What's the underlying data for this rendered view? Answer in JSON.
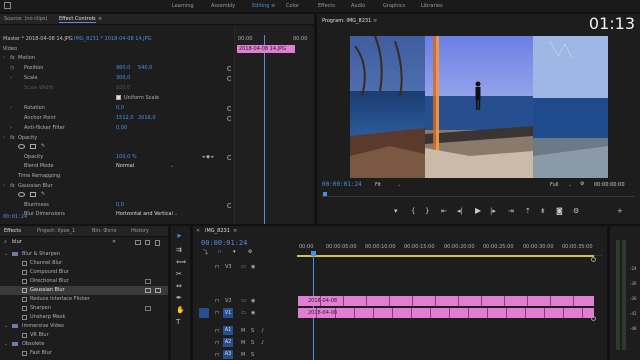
{
  "workspaces": [
    "Learning",
    "Assembly",
    "Editing",
    "Color",
    "Effects",
    "Audio",
    "Graphics",
    "Libraries"
  ],
  "active_workspace": "Editing",
  "clock": "01:13",
  "effect_controls": {
    "tabs": [
      "Source: (no clips)",
      "Effect Controls"
    ],
    "header_source": "Master * 2018-04-08 14.JPG",
    "header_clip": "IMG_8231 * 2018-04-08 14.JPG",
    "section": "Video",
    "ruler_start": "00:00",
    "ruler_end": "00:00",
    "clip_label": "2018-04-08 14.JPG",
    "motion_label": "Motion",
    "rows": [
      {
        "label": "Position",
        "v1": "960,0",
        "v2": "540,0"
      },
      {
        "label": "Scale",
        "v1": "300,0",
        "v2": ""
      },
      {
        "label": "Scale Width",
        "v1": "100,0",
        "v2": ""
      },
      {
        "label": "Uniform Scale",
        "v1": "",
        "v2": ""
      },
      {
        "label": "Rotation",
        "v1": "0,0",
        "v2": ""
      },
      {
        "label": "Anchor Point",
        "v1": "1512,0",
        "v2": "2016,0"
      },
      {
        "label": "Anti-flicker Filter",
        "v1": "0,00",
        "v2": ""
      }
    ],
    "opacity_label": "Opacity",
    "opacity_value": "100,0 %",
    "blend_label": "Blend Mode",
    "blend_value": "Normal",
    "time_remap": "Time Remapping",
    "gaussian": "Gaussian Blur",
    "blurriness_label": "Blurriness",
    "blurriness_value": "0,0",
    "blur_dim_label": "Blur Dimensions",
    "blur_dim_value": "Horizontal and Vertical",
    "timecode": "00:01:24"
  },
  "program": {
    "title": "Program: IMG_8231",
    "timecode": "00:00:01:24",
    "fit": "Fit",
    "quality": "Full",
    "duration": "00:00:00:00"
  },
  "effects_panel": {
    "tabs": [
      "Effects",
      "Project: Урок_1",
      "Bin: Фото",
      "History"
    ],
    "search": "blur",
    "items": [
      {
        "label": "Blur & Sharpen",
        "level": 0
      },
      {
        "label": "Channel Blur",
        "level": 1
      },
      {
        "label": "Compound Blur",
        "level": 1
      },
      {
        "label": "Directional Blur",
        "level": 1
      },
      {
        "label": "Gaussian Blur",
        "level": 1
      },
      {
        "label": "Reduce Interlace Flicker",
        "level": 1
      },
      {
        "label": "Sharpen",
        "level": 1
      },
      {
        "label": "Unsharp Mask",
        "level": 1
      },
      {
        "label": "Immersive Video",
        "level": 0
      },
      {
        "label": "VR Blur",
        "level": 1
      },
      {
        "label": "Obsolete",
        "level": 0
      },
      {
        "label": "Fast Blur",
        "level": 1
      }
    ]
  },
  "timeline": {
    "tab": "IMG_8231",
    "timecode": "00:00:01:24",
    "ruler": [
      "00:00",
      "00:00:05:00",
      "00:00:10:00",
      "00:00:15:00",
      "00:00:20:00",
      "00:00:25:00",
      "00:00:30:00",
      "00:00:35:00"
    ],
    "tracks": [
      "V3",
      "V2",
      "V1",
      "A1",
      "A2",
      "A3"
    ],
    "clip_v2_label": "2018-04-08",
    "clip_v1_label": "2018-04-08",
    "meter_labels": [
      "0",
      "-6",
      "-12",
      "-18",
      "-24",
      "-30",
      "-36",
      "-42",
      "-48",
      "-54"
    ]
  },
  "colors": {
    "accent": "#4d8fe0",
    "clip": "#e07fd1",
    "clip_dark": "#c25fb3"
  }
}
